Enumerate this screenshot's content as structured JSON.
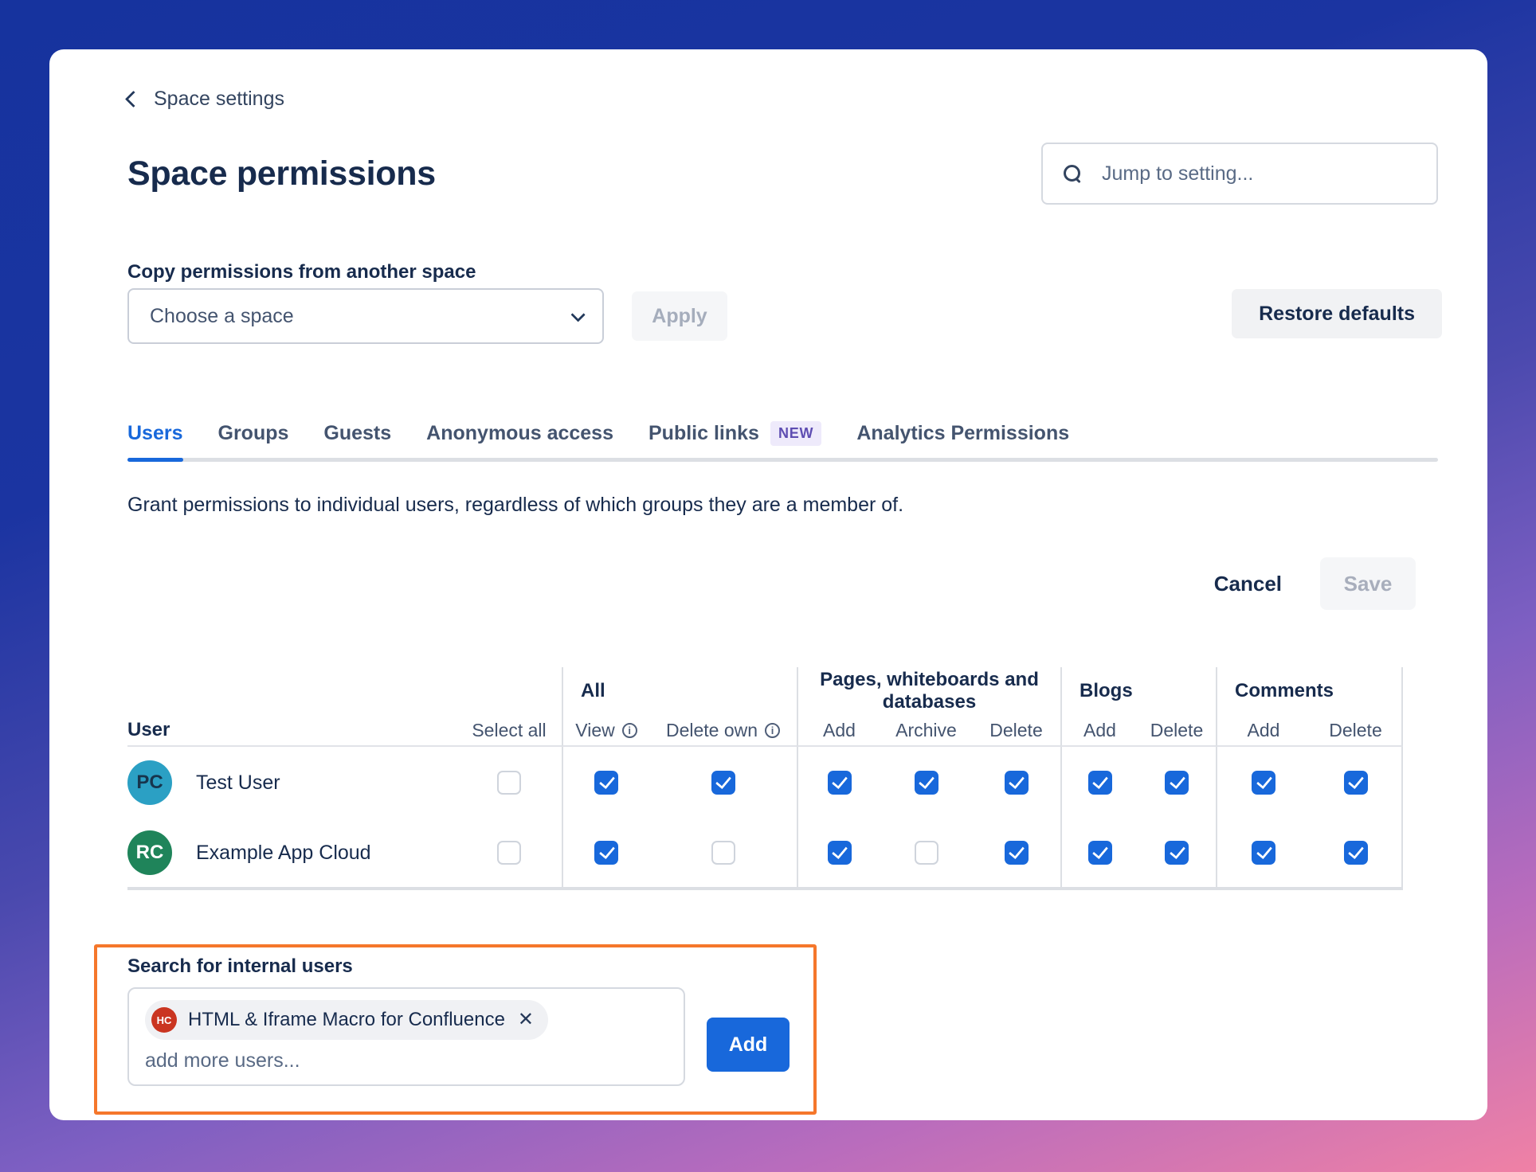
{
  "breadcrumb": {
    "back_label": "Space settings"
  },
  "page": {
    "title": "Space permissions"
  },
  "jump_search": {
    "placeholder": "Jump to setting..."
  },
  "copy_section": {
    "label": "Copy permissions from another space",
    "select_value": "Choose a space",
    "apply_label": "Apply",
    "restore_label": "Restore defaults"
  },
  "tabs": [
    {
      "label": "Users",
      "active": true
    },
    {
      "label": "Groups",
      "active": false
    },
    {
      "label": "Guests",
      "active": false
    },
    {
      "label": "Anonymous access",
      "active": false
    },
    {
      "label": "Public links",
      "active": false,
      "badge": "NEW"
    },
    {
      "label": "Analytics Permissions",
      "active": false
    }
  ],
  "description": "Grant permissions to individual users, regardless of which groups they are a member of.",
  "actions": {
    "cancel_label": "Cancel",
    "save_label": "Save"
  },
  "table": {
    "user_header": "User",
    "select_all_header": "Select all",
    "groups": [
      {
        "label": "All",
        "columns": [
          {
            "label": "View",
            "info": true
          },
          {
            "label": "Delete own",
            "info": true
          }
        ]
      },
      {
        "label": "Pages, whiteboards and databases",
        "columns": [
          {
            "label": "Add"
          },
          {
            "label": "Archive"
          },
          {
            "label": "Delete"
          }
        ]
      },
      {
        "label": "Blogs",
        "columns": [
          {
            "label": "Add"
          },
          {
            "label": "Delete"
          }
        ]
      },
      {
        "label": "Comments",
        "columns": [
          {
            "label": "Add"
          },
          {
            "label": "Delete"
          }
        ]
      }
    ],
    "rows": [
      {
        "name": "Test User",
        "initials": "PC",
        "avatar_color": "#2BA0C4",
        "initials_color": "#17354D",
        "selected": false,
        "perms": {
          "view": true,
          "delete_own": true,
          "pages_add": true,
          "pages_archive": true,
          "pages_delete": true,
          "blogs_add": true,
          "blogs_delete": true,
          "comments_add": true,
          "comments_delete": true
        }
      },
      {
        "name": "Example App Cloud",
        "initials": "RC",
        "avatar_color": "#1F845A",
        "initials_color": "#FFFFFF",
        "selected": false,
        "perms": {
          "view": true,
          "delete_own": false,
          "pages_add": true,
          "pages_archive": false,
          "pages_delete": true,
          "blogs_add": true,
          "blogs_delete": true,
          "comments_add": true,
          "comments_delete": true
        }
      }
    ]
  },
  "add_users": {
    "label": "Search for internal users",
    "chip": {
      "initials": "HC",
      "avatar_color": "#CA3521",
      "initials_color": "#FFFFFF",
      "text": "HTML & Iframe Macro for Confluence",
      "remove_glyph": "✕"
    },
    "placeholder": "add more users...",
    "add_label": "Add"
  },
  "colors": {
    "accent_blue": "#1868DB",
    "highlight_orange": "#F5772B",
    "new_badge_purple": "#5E4DB2"
  }
}
